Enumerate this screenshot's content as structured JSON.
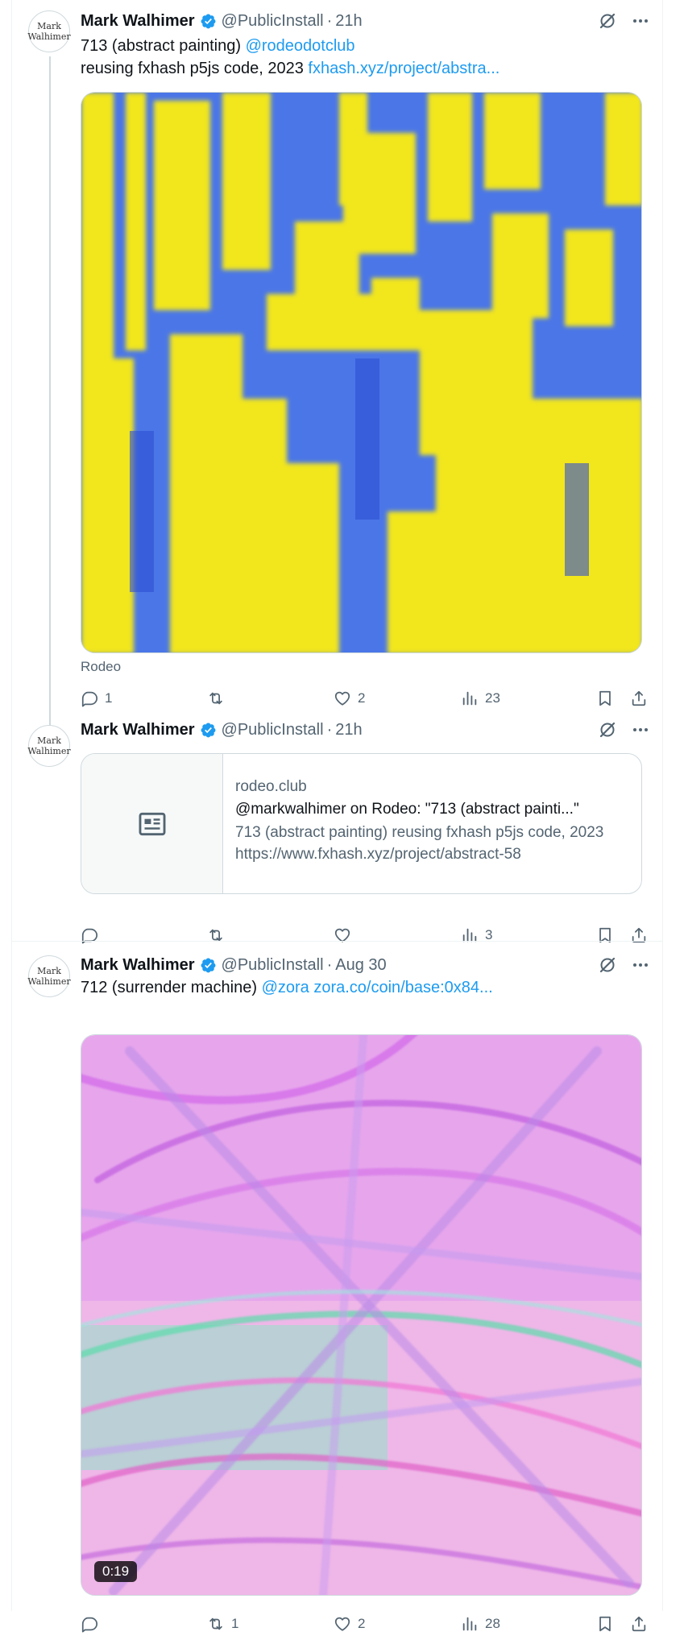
{
  "tweets": [
    {
      "author": "Mark Walhimer",
      "handle": "@PublicInstall",
      "time": "21h",
      "avatar_text": "Mark Walhimer",
      "line1_text": "713 (abstract painting)",
      "line1_link": "@rodeodotclub",
      "line2_text": "reusing fxhash p5js code, 2023",
      "line2_link": "fxhash.xyz/project/abstra...",
      "source": "Rodeo",
      "replies": "1",
      "reposts": "",
      "likes": "2",
      "views": "23"
    },
    {
      "author": "Mark Walhimer",
      "handle": "@PublicInstall",
      "time": "21h",
      "avatar_text": "Mark Walhimer",
      "card": {
        "domain": "rodeo.club",
        "title": "@markwalhimer on Rodeo: \"713 (abstract painti...\"",
        "description": "713 (abstract painting) reusing fxhash p5js code, 2023 https://www.fxhash.xyz/project/abstract-58"
      },
      "replies": "",
      "reposts": "",
      "likes": "",
      "views": "3"
    },
    {
      "author": "Mark Walhimer",
      "handle": "@PublicInstall",
      "time": "Aug 30",
      "avatar_text": "Mark Walhimer",
      "line1_text": "712 (surrender machine)",
      "line1_link": "@zora",
      "line1_link2": "zora.co/coin/base:0x84...",
      "video_duration": "0:19",
      "replies": "",
      "reposts": "1",
      "likes": "2",
      "views": "28"
    }
  ],
  "icons": {
    "verified": "verified-badge-icon",
    "grok": "grok-icon",
    "more": "more-icon",
    "reply": "reply-icon",
    "repost": "repost-icon",
    "like": "like-icon",
    "views": "views-icon",
    "bookmark": "bookmark-icon",
    "share": "share-icon",
    "card": "article-icon"
  },
  "colors": {
    "link": "#1d9bf0",
    "secondary_text": "#536471",
    "verified": "#1d9bf0"
  }
}
